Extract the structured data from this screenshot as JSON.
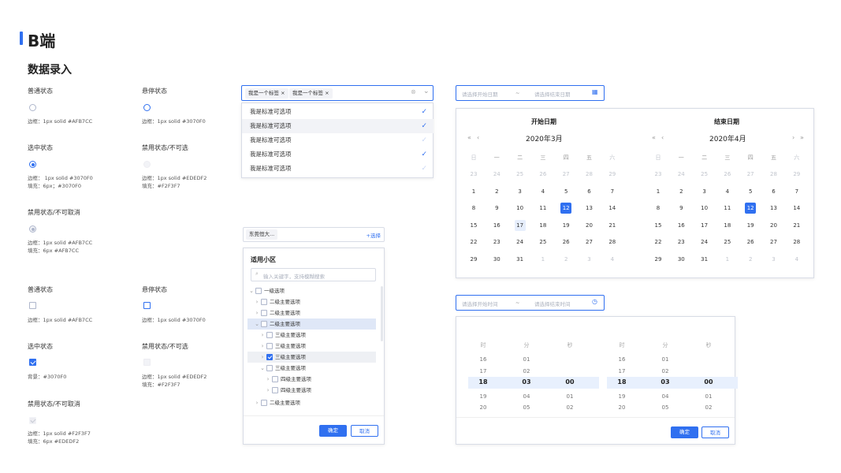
{
  "header": {
    "title": "B端",
    "subtitle": "数据录入"
  },
  "radio_section": {
    "normal": {
      "label": "普通状态",
      "cap": "边框：1px solid #AFB7CC"
    },
    "hover": {
      "label": "悬停状态",
      "cap": "边框：1px solid #3070F0"
    },
    "checked": {
      "label": "选中状态",
      "cap1": "边框：  1px solid #3070F0",
      "cap2": "填充：6px；#3070F0"
    },
    "disabled": {
      "label": "禁用状态/不可选",
      "cap1": "边框：1px solid #EDEDF2",
      "cap2": "填充：#F2F3F7"
    },
    "disabled_checked": {
      "label": "禁用状态/不可取消",
      "cap1": "边框：1px solid #AFB7CC",
      "cap2": "填充：6px #AFB7CC"
    }
  },
  "checkbox_section": {
    "normal": {
      "label": "普通状态",
      "cap": "边框：1px solid #AFB7CC"
    },
    "hover": {
      "label": "悬停状态",
      "cap": "边框：1px solid #3070F0"
    },
    "checked": {
      "label": "选中状态",
      "cap": "背景：#3070F0"
    },
    "disabled": {
      "label": "禁用状态/不可选",
      "cap1": "边框：1px solid #EDEDF2",
      "cap2": "填充：#F2F3F7"
    },
    "disabled_checked": {
      "label": "禁用状态/不可取消",
      "cap1": "边框：1px solid #F2F3F7",
      "cap2": "填充：6px #EDEDF2"
    }
  },
  "multiselect": {
    "tags": [
      "我是一个标签",
      "我是一个标签"
    ],
    "tag_close": "×",
    "options": [
      {
        "label": "我是标准可选项",
        "checked": true
      },
      {
        "label": "我是标准可选项",
        "checked": true
      },
      {
        "label": "我是标准可选项",
        "checked": false
      },
      {
        "label": "我是标准可选项",
        "checked": true
      },
      {
        "label": "我是标准可选项",
        "checked": false
      }
    ],
    "check_glyph": "✓"
  },
  "tree_select": {
    "value": "东莞恒大...",
    "action": "+选择",
    "panel_title": "适用小区",
    "search_placeholder": "输入关键字，支持模糊搜索",
    "rows": [
      "一级选项",
      "二级主要选项",
      "二级主要选项",
      "二级主要选项",
      "三级主要选项",
      "三级主要选项",
      "三级主要选项",
      "三级主要选项",
      "四级主要选项",
      "四级主要选项",
      "二级主要选项"
    ],
    "confirm": "确定",
    "cancel": "取消"
  },
  "date_range": {
    "start_placeholder": "请选择开始日期",
    "separator": "~",
    "end_placeholder": "请选择结束日期",
    "left": {
      "title": "开始日期",
      "month": "2020年3月",
      "selected": 12,
      "today": 17
    },
    "right": {
      "title": "结束日期",
      "month": "2020年4月",
      "selected": 12
    },
    "weekdays": [
      "日",
      "一",
      "二",
      "三",
      "四",
      "五",
      "六"
    ],
    "nav": {
      "prev_year": "«",
      "prev_month": "‹",
      "next_month": "›",
      "next_year": "»"
    },
    "weeks": [
      [
        23,
        24,
        25,
        26,
        27,
        28,
        29
      ],
      [
        1,
        2,
        3,
        4,
        5,
        6,
        7
      ],
      [
        8,
        9,
        10,
        11,
        12,
        13,
        14
      ],
      [
        15,
        16,
        17,
        18,
        19,
        20,
        21
      ],
      [
        22,
        23,
        24,
        25,
        26,
        27,
        28
      ],
      [
        29,
        30,
        31,
        1,
        2,
        3,
        4
      ]
    ]
  },
  "time_range": {
    "start_placeholder": "请选择开始时间",
    "separator": "~",
    "end_placeholder": "请选择结束时间",
    "headers": [
      "时",
      "分",
      "秒"
    ],
    "columns": [
      [
        "16",
        "17",
        "18",
        "19",
        "20"
      ],
      [
        "01",
        "02",
        "03",
        "04",
        "05"
      ],
      [
        "",
        "",
        "00",
        "01",
        "02"
      ]
    ],
    "confirm": "确定",
    "cancel": "取消"
  },
  "colors": {
    "primary": "#3070F0",
    "border": "#AFB7CC",
    "disabled_border": "#EDEDF2",
    "disabled_fill": "#F2F3F7"
  }
}
